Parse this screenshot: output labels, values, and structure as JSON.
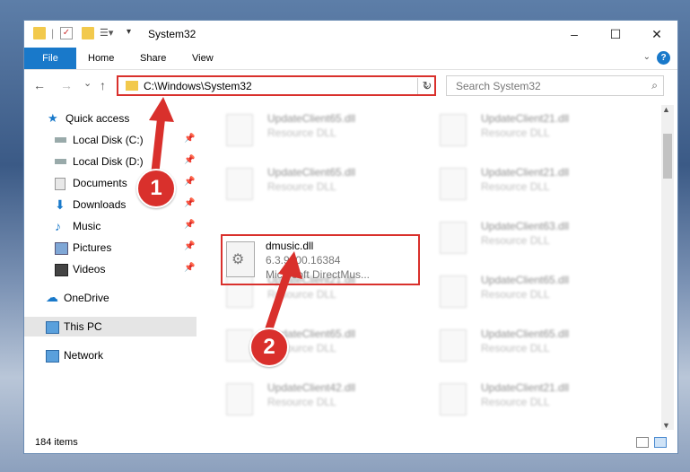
{
  "window": {
    "title": "System32",
    "controls": {
      "minimize": "–",
      "maximize": "☐",
      "close": "✕"
    }
  },
  "ribbon": {
    "tabs": [
      "File",
      "Home",
      "Share",
      "View"
    ],
    "help": "?"
  },
  "navbar": {
    "back": "←",
    "forward": "→",
    "recent": "⌄",
    "up": "↑",
    "address": "C:\\Windows\\System32",
    "search_placeholder": "Search System32"
  },
  "sidebar": {
    "quick_access": "Quick access",
    "items": [
      {
        "label": "Local Disk (C:)",
        "icon": "drive-icon"
      },
      {
        "label": "Local Disk (D:)",
        "icon": "drive-icon"
      },
      {
        "label": "Documents",
        "icon": "documents-icon"
      },
      {
        "label": "Downloads",
        "icon": "downloads-icon"
      },
      {
        "label": "Music",
        "icon": "music-icon"
      },
      {
        "label": "Pictures",
        "icon": "pictures-icon"
      },
      {
        "label": "Videos",
        "icon": "videos-icon"
      }
    ],
    "onedrive": "OneDrive",
    "this_pc": "This PC",
    "network": "Network"
  },
  "files": [
    {
      "name": "UpdateClient65.dll",
      "desc": "Resource DLL"
    },
    {
      "name": "UpdateClient21.dll",
      "desc": "Resource DLL"
    },
    {
      "name": "UpdateClient65.dll",
      "desc": "Resource DLL"
    },
    {
      "name": "UpdateClient21.dll",
      "desc": "Resource DLL"
    },
    {
      "name": "UpdateClient63.dll",
      "desc": "Resource DLL"
    },
    {
      "name": "UpdateClient21.dll",
      "desc": "Resource DLL"
    },
    {
      "name": "UpdateClient65.dll",
      "desc": "Resource DLL"
    },
    {
      "name": "UpdateClient65.dll",
      "desc": "Resource DLL"
    },
    {
      "name": "UpdateClient65.dll",
      "desc": "Resource DLL"
    },
    {
      "name": "UpdateClient42.dll",
      "desc": "Resource DLL"
    },
    {
      "name": "UpdateClient21.dll",
      "desc": "Resource DLL"
    }
  ],
  "highlighted_file": {
    "name": "dmusic.dll",
    "version": "6.3.9600.16384",
    "description": "Microsoft DirectMus..."
  },
  "status": {
    "count": "184 items"
  },
  "callouts": [
    "1",
    "2"
  ],
  "colors": {
    "accent": "#1979ca",
    "highlight": "#d9302c"
  }
}
